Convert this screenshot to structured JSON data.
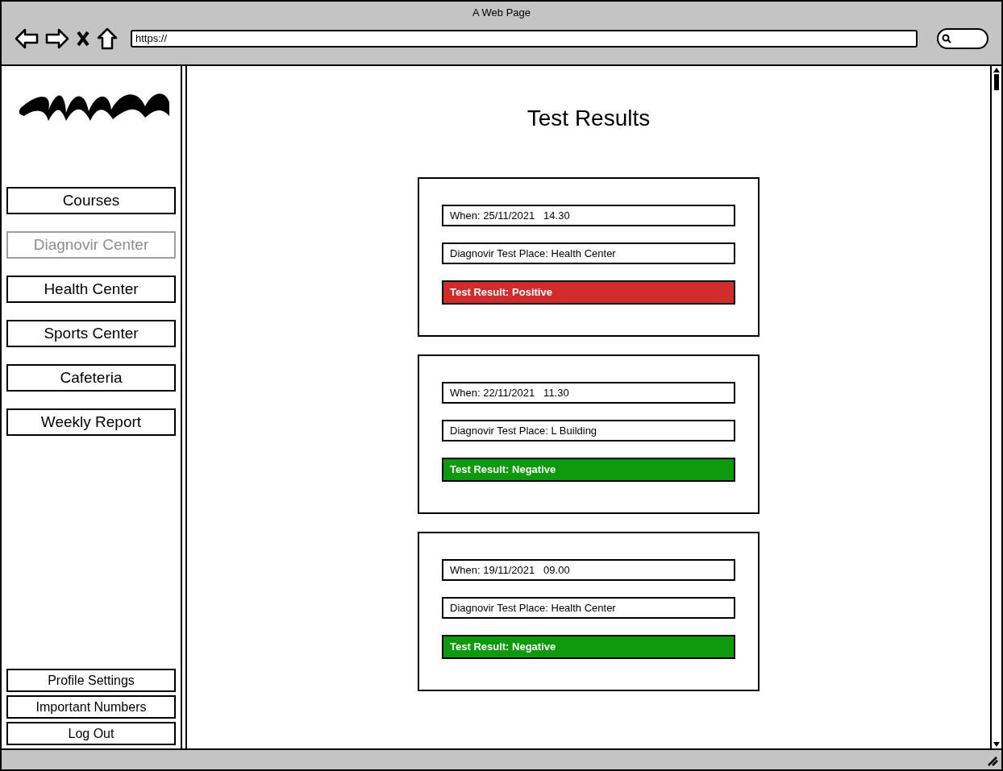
{
  "window": {
    "title": "A Web Page",
    "url": "https://"
  },
  "sidebar": {
    "items": [
      {
        "label": "Courses",
        "disabled": false
      },
      {
        "label": "Diagnovir Center",
        "disabled": true
      },
      {
        "label": "Health Center",
        "disabled": false
      },
      {
        "label": "Sports Center",
        "disabled": false
      },
      {
        "label": "Cafeteria",
        "disabled": false
      },
      {
        "label": "Weekly Report",
        "disabled": false
      }
    ],
    "bottom_items": [
      "Profile Settings",
      "Important Numbers",
      "Log Out"
    ]
  },
  "page": {
    "title": "Test Results",
    "results": [
      {
        "when": "When: 25/11/2021   14.30",
        "place": "Diagnovir Test Place: Health Center",
        "result": "Test Result: Positive",
        "kind": "positive"
      },
      {
        "when": "When: 22/11/2021   11.30",
        "place": "Diagnovir Test Place: L Building",
        "result": "Test Result: Negative",
        "kind": "negative"
      },
      {
        "when": "When: 19/11/2021   09.00",
        "place": "Diagnovir Test Place: Health Center",
        "result": "Test Result: Negative",
        "kind": "negative"
      }
    ]
  }
}
